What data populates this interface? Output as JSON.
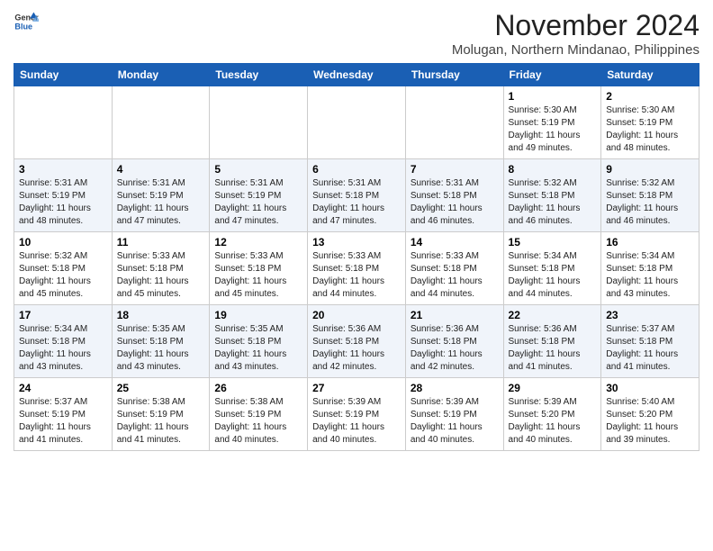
{
  "header": {
    "logo_line1": "General",
    "logo_line2": "Blue",
    "month": "November 2024",
    "location": "Molugan, Northern Mindanao, Philippines"
  },
  "weekdays": [
    "Sunday",
    "Monday",
    "Tuesday",
    "Wednesday",
    "Thursday",
    "Friday",
    "Saturday"
  ],
  "weeks": [
    [
      {
        "day": "",
        "info": ""
      },
      {
        "day": "",
        "info": ""
      },
      {
        "day": "",
        "info": ""
      },
      {
        "day": "",
        "info": ""
      },
      {
        "day": "",
        "info": ""
      },
      {
        "day": "1",
        "info": "Sunrise: 5:30 AM\nSunset: 5:19 PM\nDaylight: 11 hours and 49 minutes."
      },
      {
        "day": "2",
        "info": "Sunrise: 5:30 AM\nSunset: 5:19 PM\nDaylight: 11 hours and 48 minutes."
      }
    ],
    [
      {
        "day": "3",
        "info": "Sunrise: 5:31 AM\nSunset: 5:19 PM\nDaylight: 11 hours and 48 minutes."
      },
      {
        "day": "4",
        "info": "Sunrise: 5:31 AM\nSunset: 5:19 PM\nDaylight: 11 hours and 47 minutes."
      },
      {
        "day": "5",
        "info": "Sunrise: 5:31 AM\nSunset: 5:19 PM\nDaylight: 11 hours and 47 minutes."
      },
      {
        "day": "6",
        "info": "Sunrise: 5:31 AM\nSunset: 5:18 PM\nDaylight: 11 hours and 47 minutes."
      },
      {
        "day": "7",
        "info": "Sunrise: 5:31 AM\nSunset: 5:18 PM\nDaylight: 11 hours and 46 minutes."
      },
      {
        "day": "8",
        "info": "Sunrise: 5:32 AM\nSunset: 5:18 PM\nDaylight: 11 hours and 46 minutes."
      },
      {
        "day": "9",
        "info": "Sunrise: 5:32 AM\nSunset: 5:18 PM\nDaylight: 11 hours and 46 minutes."
      }
    ],
    [
      {
        "day": "10",
        "info": "Sunrise: 5:32 AM\nSunset: 5:18 PM\nDaylight: 11 hours and 45 minutes."
      },
      {
        "day": "11",
        "info": "Sunrise: 5:33 AM\nSunset: 5:18 PM\nDaylight: 11 hours and 45 minutes."
      },
      {
        "day": "12",
        "info": "Sunrise: 5:33 AM\nSunset: 5:18 PM\nDaylight: 11 hours and 45 minutes."
      },
      {
        "day": "13",
        "info": "Sunrise: 5:33 AM\nSunset: 5:18 PM\nDaylight: 11 hours and 44 minutes."
      },
      {
        "day": "14",
        "info": "Sunrise: 5:33 AM\nSunset: 5:18 PM\nDaylight: 11 hours and 44 minutes."
      },
      {
        "day": "15",
        "info": "Sunrise: 5:34 AM\nSunset: 5:18 PM\nDaylight: 11 hours and 44 minutes."
      },
      {
        "day": "16",
        "info": "Sunrise: 5:34 AM\nSunset: 5:18 PM\nDaylight: 11 hours and 43 minutes."
      }
    ],
    [
      {
        "day": "17",
        "info": "Sunrise: 5:34 AM\nSunset: 5:18 PM\nDaylight: 11 hours and 43 minutes."
      },
      {
        "day": "18",
        "info": "Sunrise: 5:35 AM\nSunset: 5:18 PM\nDaylight: 11 hours and 43 minutes."
      },
      {
        "day": "19",
        "info": "Sunrise: 5:35 AM\nSunset: 5:18 PM\nDaylight: 11 hours and 43 minutes."
      },
      {
        "day": "20",
        "info": "Sunrise: 5:36 AM\nSunset: 5:18 PM\nDaylight: 11 hours and 42 minutes."
      },
      {
        "day": "21",
        "info": "Sunrise: 5:36 AM\nSunset: 5:18 PM\nDaylight: 11 hours and 42 minutes."
      },
      {
        "day": "22",
        "info": "Sunrise: 5:36 AM\nSunset: 5:18 PM\nDaylight: 11 hours and 41 minutes."
      },
      {
        "day": "23",
        "info": "Sunrise: 5:37 AM\nSunset: 5:18 PM\nDaylight: 11 hours and 41 minutes."
      }
    ],
    [
      {
        "day": "24",
        "info": "Sunrise: 5:37 AM\nSunset: 5:19 PM\nDaylight: 11 hours and 41 minutes."
      },
      {
        "day": "25",
        "info": "Sunrise: 5:38 AM\nSunset: 5:19 PM\nDaylight: 11 hours and 41 minutes."
      },
      {
        "day": "26",
        "info": "Sunrise: 5:38 AM\nSunset: 5:19 PM\nDaylight: 11 hours and 40 minutes."
      },
      {
        "day": "27",
        "info": "Sunrise: 5:39 AM\nSunset: 5:19 PM\nDaylight: 11 hours and 40 minutes."
      },
      {
        "day": "28",
        "info": "Sunrise: 5:39 AM\nSunset: 5:19 PM\nDaylight: 11 hours and 40 minutes."
      },
      {
        "day": "29",
        "info": "Sunrise: 5:39 AM\nSunset: 5:20 PM\nDaylight: 11 hours and 40 minutes."
      },
      {
        "day": "30",
        "info": "Sunrise: 5:40 AM\nSunset: 5:20 PM\nDaylight: 11 hours and 39 minutes."
      }
    ]
  ]
}
